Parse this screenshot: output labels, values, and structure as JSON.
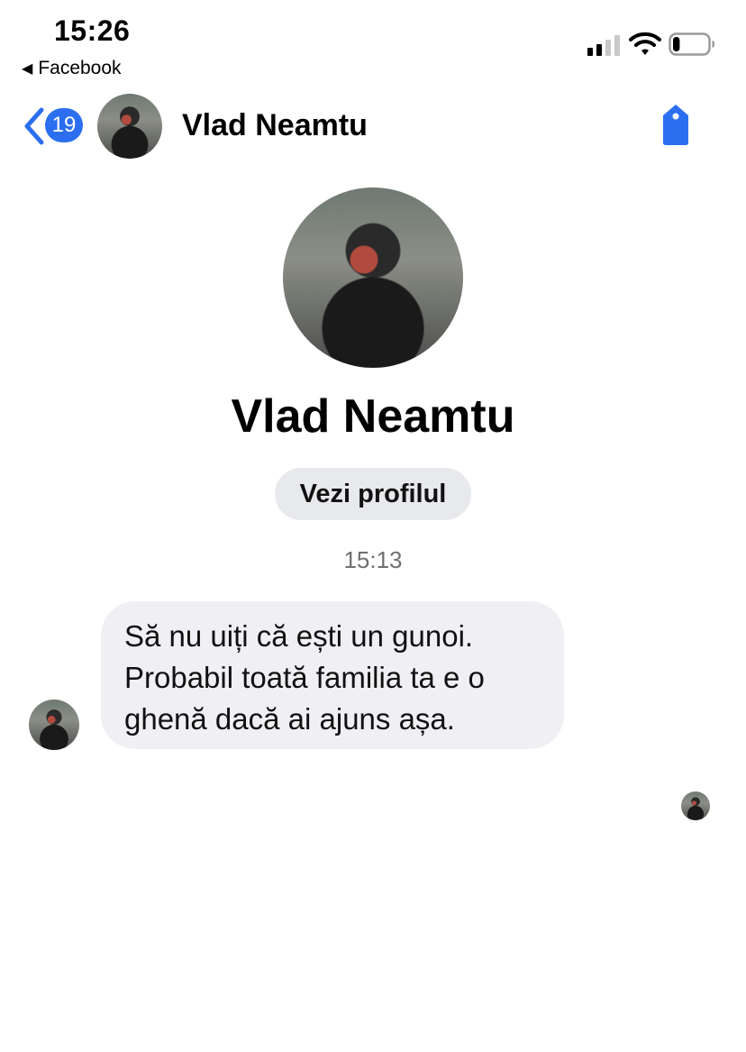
{
  "status_bar": {
    "time": "15:26",
    "back_app_label": "Facebook",
    "signal_bars_active": 2,
    "signal_bars_total": 4,
    "battery_level": 0.2
  },
  "header": {
    "unread_count": "19",
    "contact_name": "Vlad Neamtu",
    "accent_color": "#2b6ff0",
    "right_icon": "tag-icon"
  },
  "profile": {
    "name": "Vlad Neamtu",
    "view_profile_label": "Vezi profilul"
  },
  "conversation": {
    "timestamp": "15:13",
    "messages": [
      {
        "sender": "Vlad Neamtu",
        "text": "Să nu uiți că ești un gunoi. Probabil toată familia ta e o ghenă dacă ai ajuns așa."
      }
    ]
  }
}
